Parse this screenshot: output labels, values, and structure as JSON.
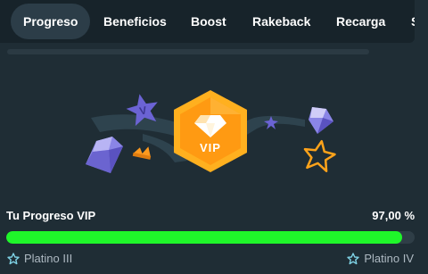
{
  "tabs": [
    {
      "label": "Progreso",
      "active": true
    },
    {
      "label": "Beneficios",
      "active": false
    },
    {
      "label": "Boost",
      "active": false
    },
    {
      "label": "Rakeback",
      "active": false
    },
    {
      "label": "Recarga",
      "active": false
    },
    {
      "label": "S",
      "active": false
    }
  ],
  "badge": {
    "label": "VIP"
  },
  "progress": {
    "label": "Tu Progreso VIP",
    "value_text": "97,00 %",
    "fraction": 0.97
  },
  "tiers": {
    "current": "Platino III",
    "next": "Platino IV"
  },
  "colors": {
    "accent_green": "#1ff62a",
    "badge_orange": "#ffa31a",
    "background": "#1f2d35"
  },
  "icons": [
    "star-icon",
    "diamond-icon",
    "crown-icon",
    "vip-badge-icon"
  ]
}
